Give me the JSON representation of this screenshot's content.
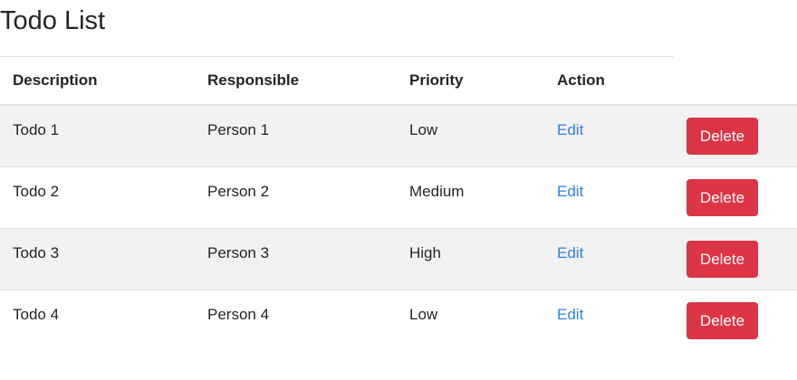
{
  "page": {
    "title": "Todo List"
  },
  "table": {
    "headers": {
      "description": "Description",
      "responsible": "Responsible",
      "priority": "Priority",
      "action": "Action"
    },
    "rows": [
      {
        "description": "Todo 1",
        "responsible": "Person 1",
        "priority": "Low",
        "edit_label": "Edit",
        "delete_label": "Delete"
      },
      {
        "description": "Todo 2",
        "responsible": "Person 2",
        "priority": "Medium",
        "edit_label": "Edit",
        "delete_label": "Delete"
      },
      {
        "description": "Todo 3",
        "responsible": "Person 3",
        "priority": "High",
        "edit_label": "Edit",
        "delete_label": "Delete"
      },
      {
        "description": "Todo 4",
        "responsible": "Person 4",
        "priority": "Low",
        "edit_label": "Edit",
        "delete_label": "Delete"
      }
    ]
  },
  "colors": {
    "delete_button": "#dc3545",
    "edit_link": "#2f80ed",
    "striped_row": "#f2f2f2"
  }
}
